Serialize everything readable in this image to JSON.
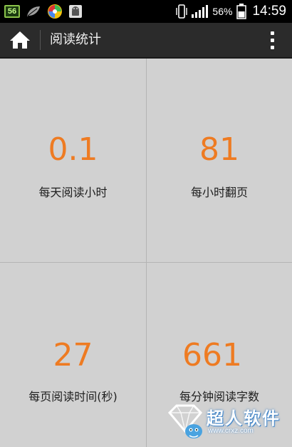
{
  "status_bar": {
    "app_badge": "56",
    "battery_percent": "56%",
    "time": "14:59",
    "icons": [
      "app-56-icon",
      "leaf-icon",
      "pinwheel-icon",
      "android-icon",
      "phone-vibrate-icon",
      "signal-icon",
      "battery-icon"
    ]
  },
  "action_bar": {
    "title": "阅读统计",
    "home_icon": "home-icon",
    "menu_icon": "overflow-menu-icon"
  },
  "stats": [
    {
      "value": "0.1",
      "label": "每天阅读小时"
    },
    {
      "value": "81",
      "label": "每小时翻页"
    },
    {
      "value": "27",
      "label": "每页阅读时间(秒)"
    },
    {
      "value": "661",
      "label": "每分钟阅读字数"
    }
  ],
  "watermark": {
    "brand": "超人软件",
    "url": "www.crxz.com"
  },
  "colors": {
    "accent": "#ee7b22",
    "action_bar": "#2b2b2b",
    "tile": "#d1d1d1",
    "divider": "#b4b4b4"
  }
}
